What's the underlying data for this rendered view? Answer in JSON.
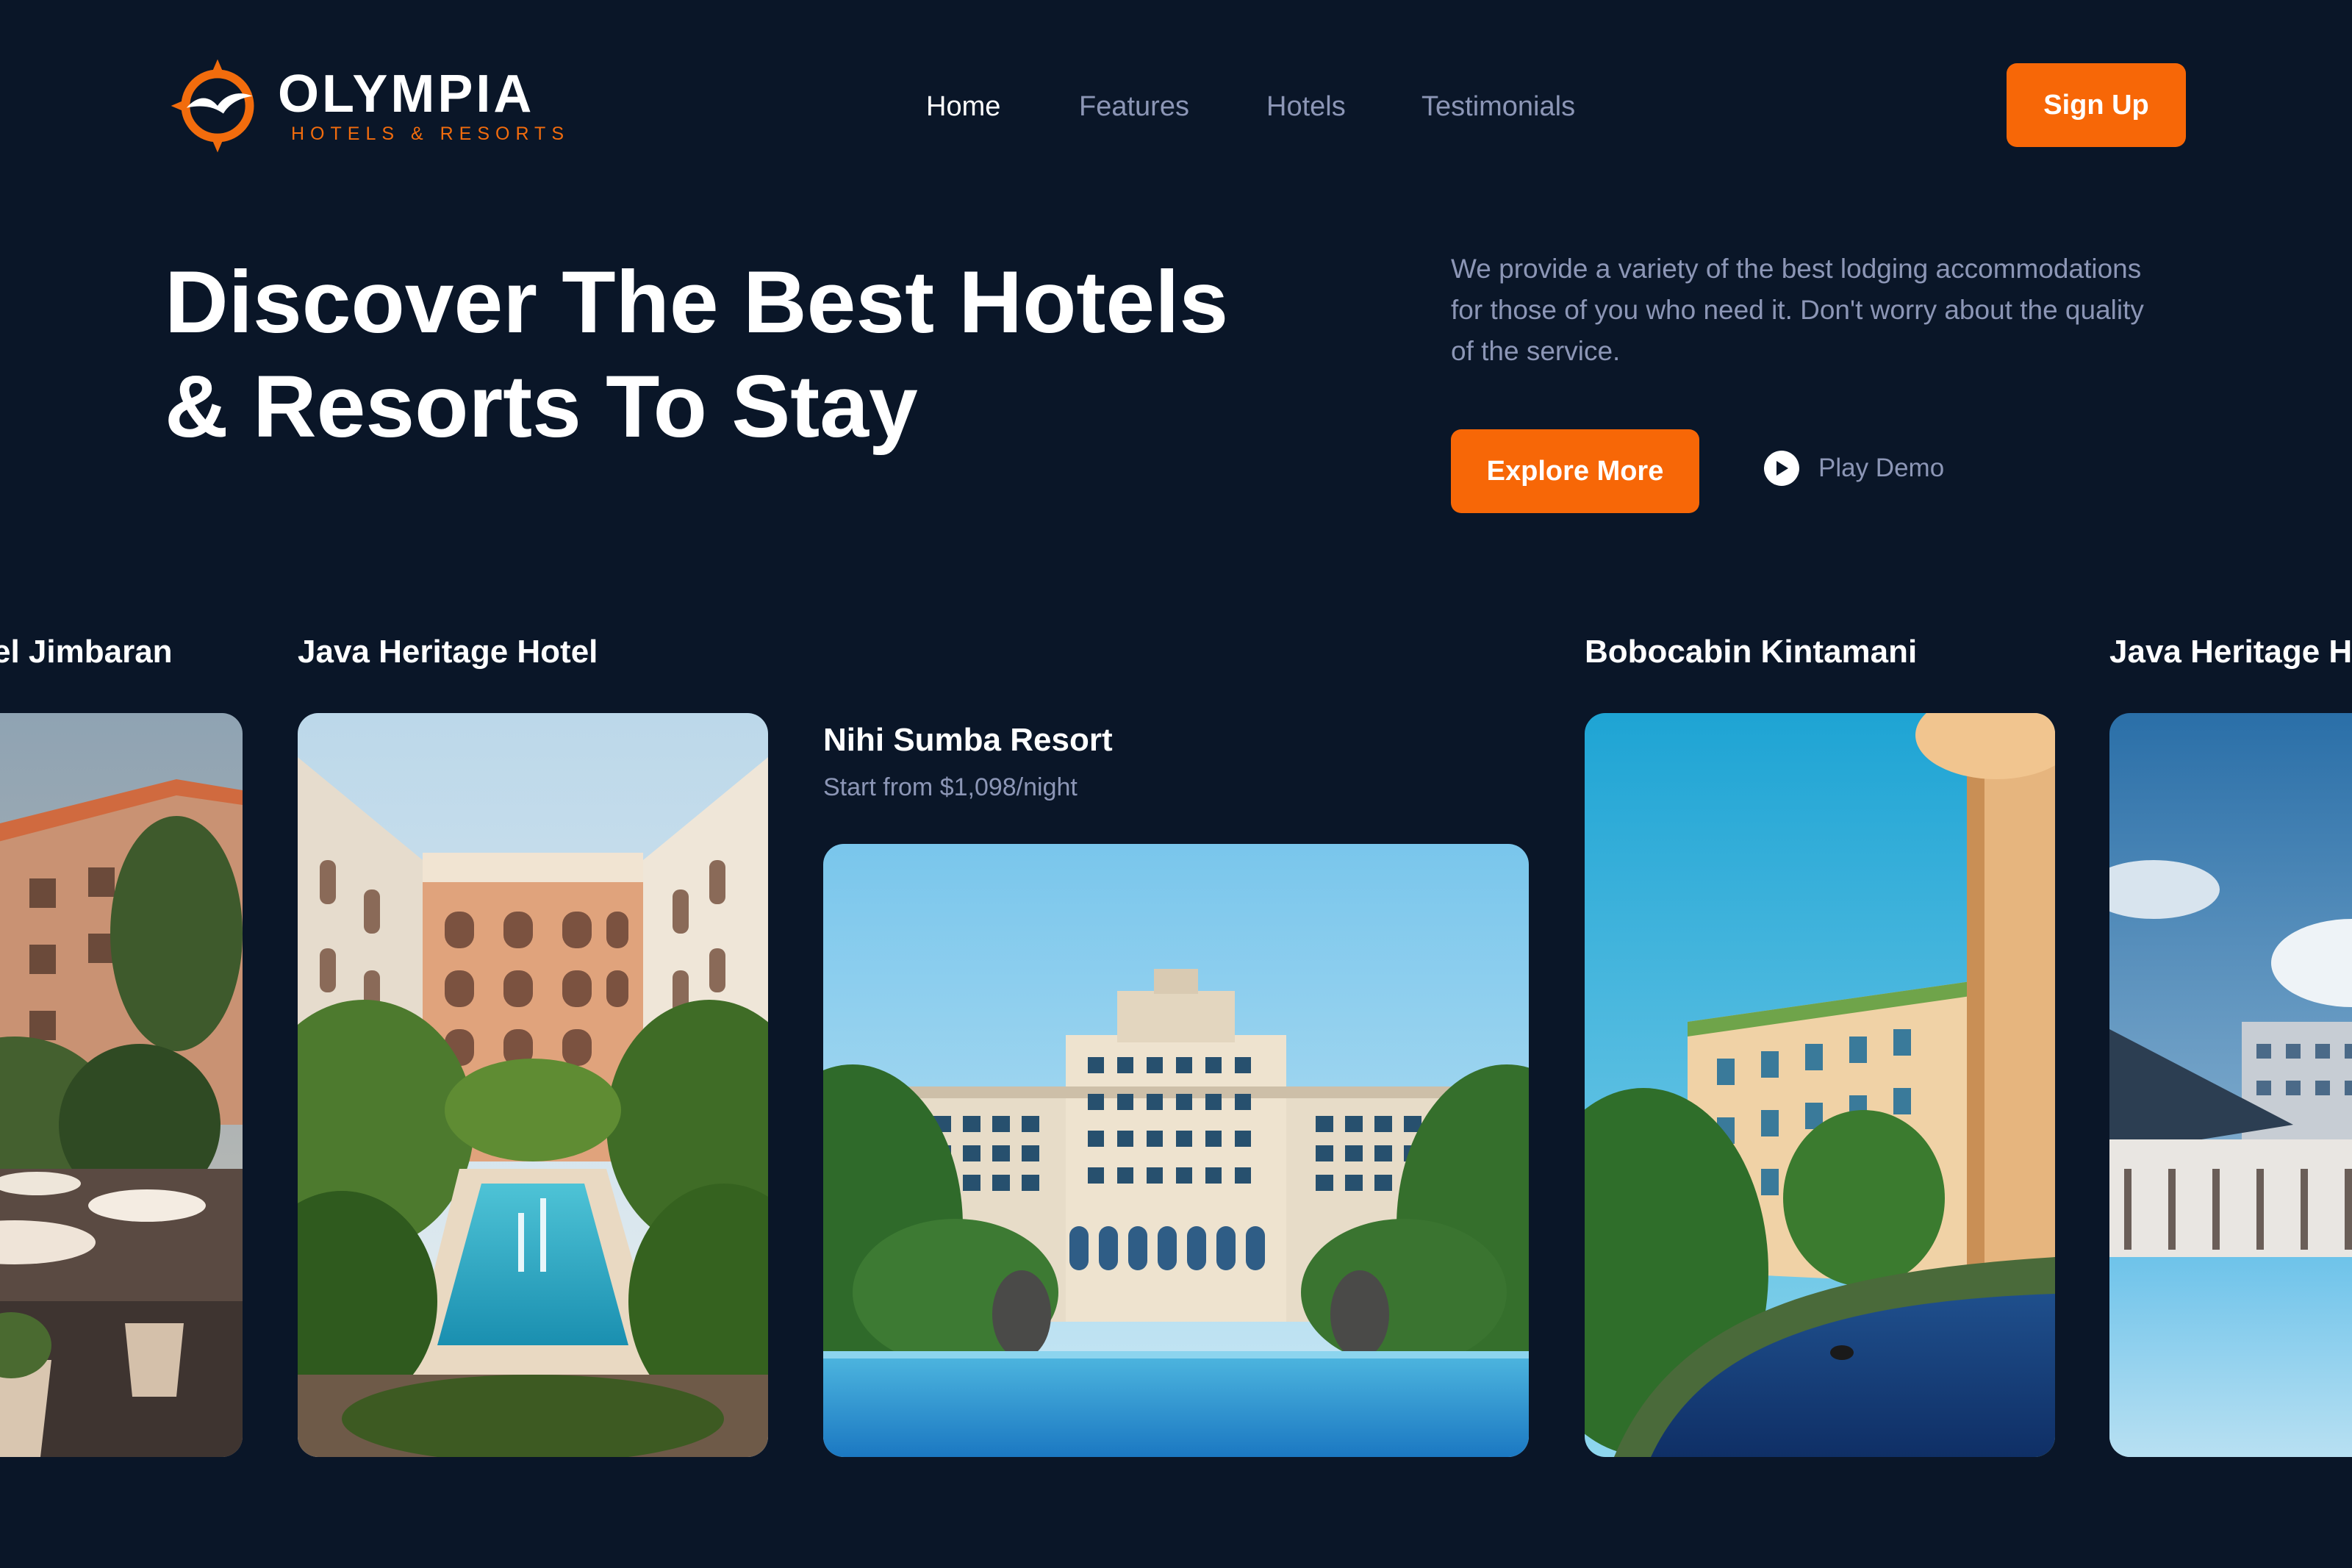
{
  "brand": {
    "name": "OLYMPIA",
    "tagline": "HOTELS & RESORTS",
    "accent_color": "#f76707",
    "background_color": "#0a1628",
    "logo_icon": "seagull-sun-icon"
  },
  "nav": {
    "items": [
      {
        "label": "Home",
        "active": true
      },
      {
        "label": "Features",
        "active": false
      },
      {
        "label": "Hotels",
        "active": false
      },
      {
        "label": "Testimonials",
        "active": false
      }
    ],
    "cta_label": "Sign Up"
  },
  "hero": {
    "title_line1": "Discover The Best Hotels",
    "title_line2": "& Resorts To Stay",
    "description": "We provide a variety of the best lodging accommodations for those of you who need it. Don't worry about the quality of the service.",
    "primary_button": "Explore More",
    "secondary_button": "Play Demo",
    "secondary_icon": "play-icon"
  },
  "hotels": [
    {
      "name": "el Jimbaran",
      "subtitle": "",
      "featured": false
    },
    {
      "name": "Java Heritage Hotel",
      "subtitle": "",
      "featured": false
    },
    {
      "name": "Nihi Sumba Resort",
      "subtitle": "Start from $1,098/night",
      "featured": true
    },
    {
      "name": "Bobocabin Kintamani",
      "subtitle": "",
      "featured": false
    },
    {
      "name": "Java Heritage H",
      "subtitle": "",
      "featured": false
    }
  ]
}
